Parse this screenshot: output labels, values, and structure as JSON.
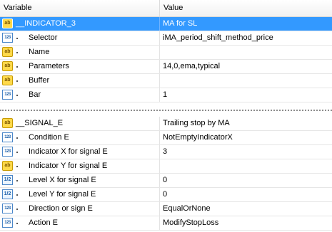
{
  "top": {
    "header": {
      "variable": "Variable",
      "value": "Value"
    },
    "rows": [
      {
        "icon": "string-icon",
        "icon_text": "ab",
        "name": "__INDICATOR_3",
        "value": "MA for SL",
        "selected": true,
        "parent": true
      },
      {
        "icon": "integer-icon",
        "icon_text": "123",
        "name": "Selector",
        "value": "iMA_period_shift_method_price"
      },
      {
        "icon": "string-icon",
        "icon_text": "ab",
        "name": "Name",
        "value": ""
      },
      {
        "icon": "string-icon",
        "icon_text": "ab",
        "name": "Parameters",
        "value": "14,0,ema,typical"
      },
      {
        "icon": "string-icon",
        "icon_text": "ab",
        "name": "Buffer",
        "value": ""
      },
      {
        "icon": "integer-icon",
        "icon_text": "123",
        "name": "Bar",
        "value": "1"
      }
    ]
  },
  "bottom": {
    "rows": [
      {
        "icon": "string-icon",
        "icon_text": "ab",
        "name": "__SIGNAL_E",
        "value": "Trailing stop by MA",
        "parent": true
      },
      {
        "icon": "integer-icon",
        "icon_text": "123",
        "name": "Condition E",
        "value": "NotEmptyIndicatorX"
      },
      {
        "icon": "integer-icon",
        "icon_text": "123",
        "name": "Indicator X for signal E",
        "value": "3"
      },
      {
        "icon": "string-icon",
        "icon_text": "ab",
        "name": "Indicator Y for signal E",
        "value": ""
      },
      {
        "icon": "double-icon",
        "icon_text": "1/2",
        "name": "Level X for signal E",
        "value": "0"
      },
      {
        "icon": "double-icon",
        "icon_text": "1/2",
        "name": "Level Y for signal E",
        "value": "0"
      },
      {
        "icon": "integer-icon",
        "icon_text": "123",
        "name": "Direction or sign E",
        "value": "EqualOrNone"
      },
      {
        "icon": "integer-icon",
        "icon_text": "123",
        "name": "Action E",
        "value": "ModifyStopLoss"
      }
    ]
  }
}
